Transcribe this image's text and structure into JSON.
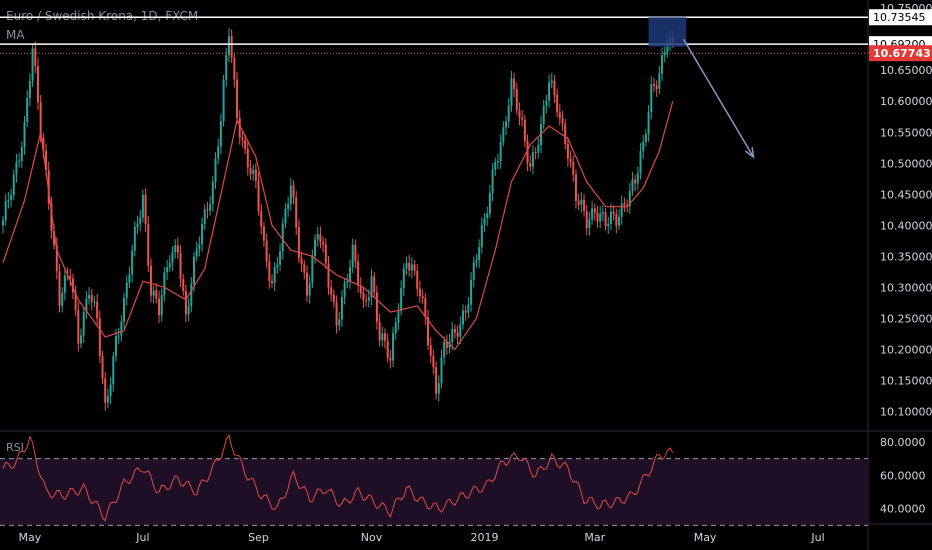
{
  "title": "Euro / Swedish Krona, 1D, FXCM",
  "ma_label": "MA",
  "rsi_label": "RSI",
  "colors": {
    "background": "#000000",
    "up": "#26a69a",
    "down": "#ef5350",
    "ma": "#e04848",
    "rsi": "#e04848",
    "rsi_band": "#1f0f26",
    "level_line": "#ffffff",
    "dotted_level": "#e06a2a",
    "box": "#1e3a7a",
    "arrow": "#7e9bc2",
    "axis_text": "#d1d4dc"
  },
  "chart_data": {
    "type": "candlestick",
    "symbol": "Euro / Swedish Krona",
    "interval": "1D",
    "source": "FXCM",
    "ylim": [
      10.07,
      10.76
    ],
    "y_ticks": [
      "10.75000",
      "10.70000",
      "10.65000",
      "10.60000",
      "10.55000",
      "10.50000",
      "10.45000",
      "10.40000",
      "10.35000",
      "10.30000",
      "10.25000",
      "10.20000",
      "10.15000",
      "10.10000"
    ],
    "x_ticks": [
      "May",
      "Jul",
      "Sep",
      "Nov",
      "2019",
      "Mar",
      "May",
      "Jul"
    ],
    "price_path": [
      [
        0,
        10.4
      ],
      [
        4,
        10.48
      ],
      [
        8,
        10.56
      ],
      [
        11,
        10.68
      ],
      [
        14,
        10.55
      ],
      [
        17,
        10.45
      ],
      [
        21,
        10.28
      ],
      [
        25,
        10.32
      ],
      [
        28,
        10.22
      ],
      [
        32,
        10.3
      ],
      [
        35,
        10.24
      ],
      [
        38,
        10.1
      ],
      [
        42,
        10.22
      ],
      [
        45,
        10.27
      ],
      [
        49,
        10.38
      ],
      [
        52,
        10.45
      ],
      [
        55,
        10.3
      ],
      [
        58,
        10.26
      ],
      [
        62,
        10.35
      ],
      [
        65,
        10.37
      ],
      [
        68,
        10.25
      ],
      [
        71,
        10.33
      ],
      [
        74,
        10.4
      ],
      [
        78,
        10.47
      ],
      [
        81,
        10.57
      ],
      [
        84,
        10.71
      ],
      [
        87,
        10.58
      ],
      [
        90,
        10.52
      ],
      [
        94,
        10.46
      ],
      [
        97,
        10.36
      ],
      [
        100,
        10.31
      ],
      [
        103,
        10.37
      ],
      [
        107,
        10.46
      ],
      [
        110,
        10.36
      ],
      [
        113,
        10.3
      ],
      [
        117,
        10.39
      ],
      [
        120,
        10.33
      ],
      [
        124,
        10.25
      ],
      [
        127,
        10.3
      ],
      [
        130,
        10.35
      ],
      [
        134,
        10.27
      ],
      [
        137,
        10.32
      ],
      [
        140,
        10.22
      ],
      [
        144,
        10.18
      ],
      [
        147,
        10.28
      ],
      [
        150,
        10.35
      ],
      [
        154,
        10.3
      ],
      [
        157,
        10.25
      ],
      [
        161,
        10.14
      ],
      [
        164,
        10.2
      ],
      [
        168,
        10.22
      ],
      [
        172,
        10.27
      ],
      [
        175,
        10.33
      ],
      [
        179,
        10.4
      ],
      [
        183,
        10.51
      ],
      [
        186,
        10.55
      ],
      [
        189,
        10.62
      ],
      [
        193,
        10.56
      ],
      [
        196,
        10.5
      ],
      [
        200,
        10.55
      ],
      [
        203,
        10.63
      ],
      [
        206,
        10.6
      ],
      [
        210,
        10.52
      ],
      [
        213,
        10.44
      ],
      [
        217,
        10.41
      ],
      [
        220,
        10.43
      ],
      [
        224,
        10.4
      ],
      [
        228,
        10.41
      ],
      [
        232,
        10.45
      ],
      [
        235,
        10.47
      ],
      [
        238,
        10.52
      ],
      [
        241,
        10.62
      ],
      [
        244,
        10.65
      ],
      [
        247,
        10.7
      ],
      [
        249,
        10.678
      ]
    ],
    "ma_path": [
      [
        0,
        10.34
      ],
      [
        8,
        10.44
      ],
      [
        14,
        10.55
      ],
      [
        20,
        10.36
      ],
      [
        28,
        10.28
      ],
      [
        38,
        10.22
      ],
      [
        45,
        10.23
      ],
      [
        52,
        10.31
      ],
      [
        60,
        10.3
      ],
      [
        68,
        10.28
      ],
      [
        75,
        10.33
      ],
      [
        82,
        10.47
      ],
      [
        87,
        10.57
      ],
      [
        94,
        10.51
      ],
      [
        100,
        10.4
      ],
      [
        107,
        10.36
      ],
      [
        115,
        10.35
      ],
      [
        124,
        10.32
      ],
      [
        134,
        10.3
      ],
      [
        144,
        10.26
      ],
      [
        154,
        10.27
      ],
      [
        161,
        10.23
      ],
      [
        168,
        10.2
      ],
      [
        176,
        10.25
      ],
      [
        183,
        10.36
      ],
      [
        189,
        10.47
      ],
      [
        196,
        10.53
      ],
      [
        203,
        10.56
      ],
      [
        210,
        10.54
      ],
      [
        217,
        10.47
      ],
      [
        224,
        10.43
      ],
      [
        232,
        10.43
      ],
      [
        238,
        10.46
      ],
      [
        244,
        10.52
      ],
      [
        249,
        10.6
      ]
    ],
    "rsi_path": [
      [
        0,
        64
      ],
      [
        5,
        68
      ],
      [
        10,
        82
      ],
      [
        16,
        50
      ],
      [
        22,
        48
      ],
      [
        30,
        52
      ],
      [
        38,
        35
      ],
      [
        45,
        55
      ],
      [
        52,
        65
      ],
      [
        58,
        50
      ],
      [
        65,
        58
      ],
      [
        72,
        50
      ],
      [
        78,
        64
      ],
      [
        84,
        82
      ],
      [
        90,
        62
      ],
      [
        96,
        48
      ],
      [
        102,
        40
      ],
      [
        108,
        60
      ],
      [
        114,
        46
      ],
      [
        120,
        52
      ],
      [
        126,
        42
      ],
      [
        132,
        50
      ],
      [
        138,
        44
      ],
      [
        144,
        38
      ],
      [
        150,
        52
      ],
      [
        156,
        44
      ],
      [
        162,
        40
      ],
      [
        168,
        45
      ],
      [
        174,
        50
      ],
      [
        180,
        54
      ],
      [
        186,
        68
      ],
      [
        192,
        72
      ],
      [
        198,
        60
      ],
      [
        204,
        70
      ],
      [
        210,
        64
      ],
      [
        216,
        46
      ],
      [
        222,
        42
      ],
      [
        228,
        44
      ],
      [
        234,
        48
      ],
      [
        240,
        62
      ],
      [
        244,
        72
      ],
      [
        249,
        74
      ]
    ],
    "rsi_ylim": [
      32,
      86
    ],
    "rsi_ticks": [
      "80.0000",
      "60.0000",
      "40.0000"
    ],
    "rsi_bands": [
      70,
      30
    ],
    "levels": [
      {
        "label": "10.73545",
        "value": 10.73545
      },
      {
        "label": "10.69200",
        "value": 10.692
      }
    ],
    "last_price": {
      "label": "10.67743",
      "value": 10.67743
    }
  }
}
